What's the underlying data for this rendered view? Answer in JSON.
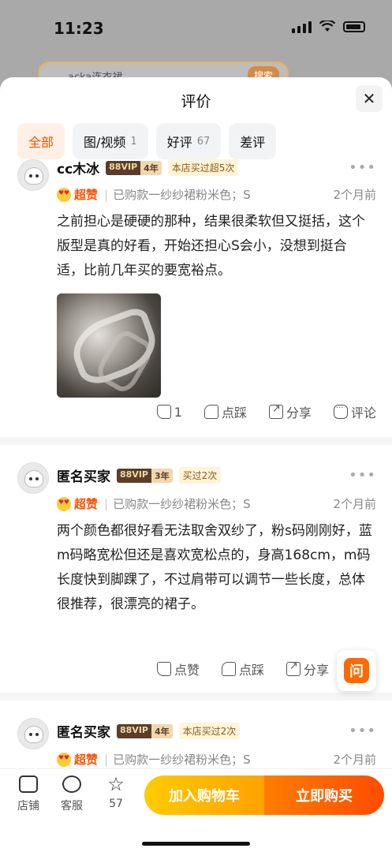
{
  "status_bar": {
    "time": "11:23"
  },
  "behind": {
    "search_text": "acka连衣裙",
    "search_button": "搜索"
  },
  "sheet": {
    "title": "评价",
    "close_glyph": "✕",
    "filters": [
      {
        "label": "全部",
        "count": ""
      },
      {
        "label": "图/视频",
        "count": "1"
      },
      {
        "label": "好评",
        "count": "67"
      },
      {
        "label": "差评",
        "count": ""
      }
    ]
  },
  "reviews": [
    {
      "name": "cc木冰",
      "vip": "88VIP",
      "years": "4年",
      "tag": "本店买过超5次",
      "rating": "超赞",
      "sku": "已购款一纱纱裙粉米色；S",
      "ago": "2个月前",
      "content": "之前担心是硬硬的那种，结果很柔软但又挺括，这个版型是真的好看，开始还担心S会小，没想到挺合适，比前几年买的要宽裕点。",
      "likes": "1",
      "dislike_label": "点踩",
      "share_label": "分享",
      "comment_label": "评论"
    },
    {
      "name": "匿名买家",
      "vip": "88VIP",
      "years": "3年",
      "tag": "买过2次",
      "rating": "超赞",
      "sku": "已购款一纱纱裙粉米色；S",
      "ago": "2个月前",
      "content": "两个颜色都很好看无法取舍双纱了，粉s码刚刚好，蓝m码略宽松但还是喜欢宽松点的，身高168cm，m码长度快到脚踝了，不过肩带可以调节一些长度，总体很推荐，很漂亮的裙子。",
      "like_label": "点赞",
      "dislike_label": "点踩",
      "share_label": "分享"
    },
    {
      "name": "匿名买家",
      "vip": "88VIP",
      "years": "4年",
      "tag": "本店买过2次",
      "rating": "超赞",
      "sku": "已购款一纱纱裙粉米色；S",
      "ago": "2个月前"
    }
  ],
  "ask_button": "问",
  "bottom_bar": {
    "shop": "店铺",
    "service": "客服",
    "fav_count": "57",
    "add_to_cart": "加入购物车",
    "buy_now": "立即购买"
  },
  "colors": {
    "accent": "#ff5000",
    "cart_yellow": "#ffb000",
    "buy_orange": "#ff5a00"
  }
}
